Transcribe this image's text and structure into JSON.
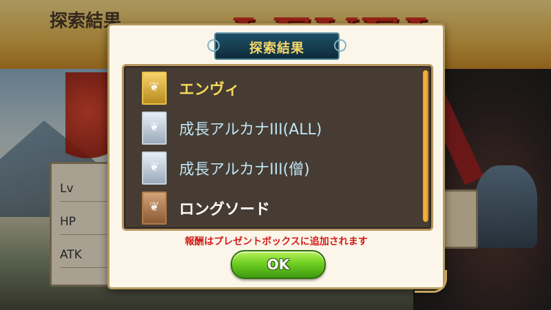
{
  "background": {
    "banner_title": "探索結果",
    "levelup_text": "LEVEL UP!",
    "stats": [
      "Lv",
      "HP",
      "ATK"
    ]
  },
  "dialog": {
    "title": "探索結果",
    "items": [
      {
        "name": "エンヴィ",
        "rarity": "gold",
        "icon": "arcana-card-icon"
      },
      {
        "name": "成長アルカナIII(ALL)",
        "rarity": "silver",
        "icon": "arcana-card-icon"
      },
      {
        "name": "成長アルカナIII(僧)",
        "rarity": "silver",
        "icon": "arcana-card-icon"
      },
      {
        "name": "ロングソード",
        "rarity": "bronze",
        "icon": "arcana-card-icon"
      }
    ],
    "note": "報酬はプレゼントボックスに追加されます",
    "ok_label": "OK"
  },
  "colors": {
    "accent_gold": "#f5d85a",
    "note_red": "#d21c1c",
    "ok_green": "#6fcf22",
    "list_bg": "#463c33"
  }
}
